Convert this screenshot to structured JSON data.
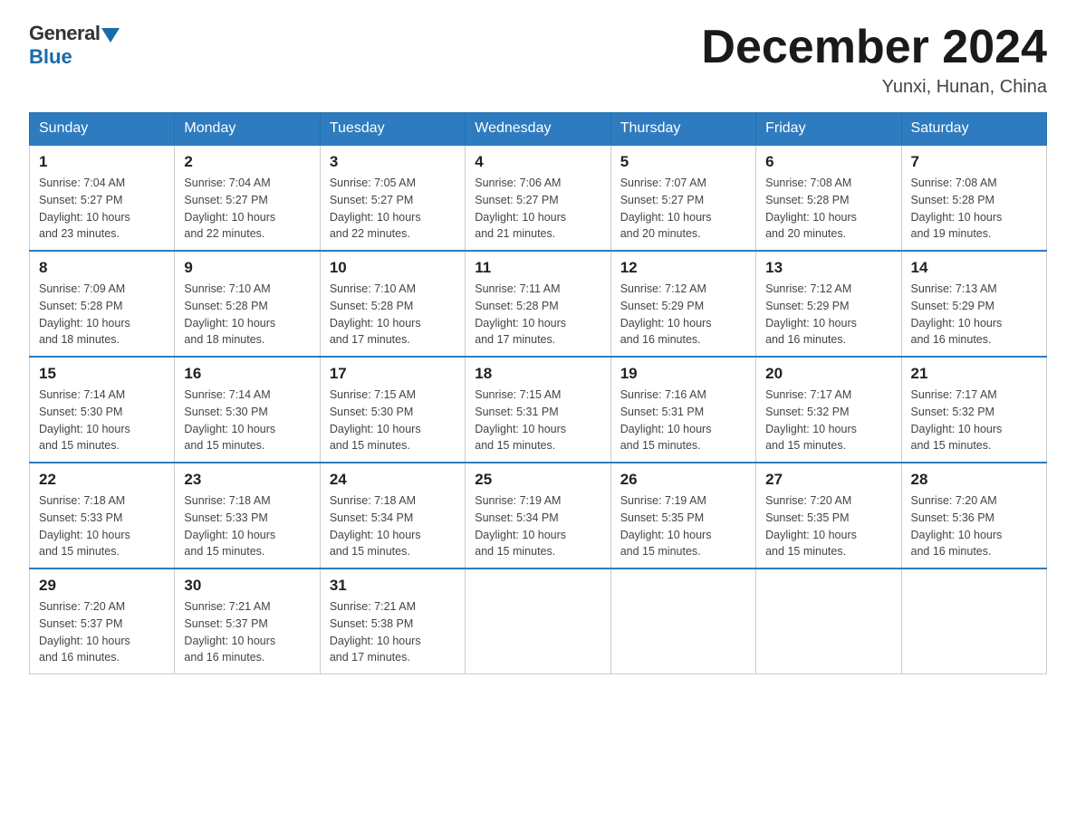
{
  "header": {
    "logo_general": "General",
    "logo_blue": "Blue",
    "month_title": "December 2024",
    "location": "Yunxi, Hunan, China"
  },
  "days_of_week": [
    "Sunday",
    "Monday",
    "Tuesday",
    "Wednesday",
    "Thursday",
    "Friday",
    "Saturday"
  ],
  "weeks": [
    [
      {
        "day": "1",
        "sunrise": "7:04 AM",
        "sunset": "5:27 PM",
        "daylight": "10 hours and 23 minutes."
      },
      {
        "day": "2",
        "sunrise": "7:04 AM",
        "sunset": "5:27 PM",
        "daylight": "10 hours and 22 minutes."
      },
      {
        "day": "3",
        "sunrise": "7:05 AM",
        "sunset": "5:27 PM",
        "daylight": "10 hours and 22 minutes."
      },
      {
        "day": "4",
        "sunrise": "7:06 AM",
        "sunset": "5:27 PM",
        "daylight": "10 hours and 21 minutes."
      },
      {
        "day": "5",
        "sunrise": "7:07 AM",
        "sunset": "5:27 PM",
        "daylight": "10 hours and 20 minutes."
      },
      {
        "day": "6",
        "sunrise": "7:08 AM",
        "sunset": "5:28 PM",
        "daylight": "10 hours and 20 minutes."
      },
      {
        "day": "7",
        "sunrise": "7:08 AM",
        "sunset": "5:28 PM",
        "daylight": "10 hours and 19 minutes."
      }
    ],
    [
      {
        "day": "8",
        "sunrise": "7:09 AM",
        "sunset": "5:28 PM",
        "daylight": "10 hours and 18 minutes."
      },
      {
        "day": "9",
        "sunrise": "7:10 AM",
        "sunset": "5:28 PM",
        "daylight": "10 hours and 18 minutes."
      },
      {
        "day": "10",
        "sunrise": "7:10 AM",
        "sunset": "5:28 PM",
        "daylight": "10 hours and 17 minutes."
      },
      {
        "day": "11",
        "sunrise": "7:11 AM",
        "sunset": "5:28 PM",
        "daylight": "10 hours and 17 minutes."
      },
      {
        "day": "12",
        "sunrise": "7:12 AM",
        "sunset": "5:29 PM",
        "daylight": "10 hours and 16 minutes."
      },
      {
        "day": "13",
        "sunrise": "7:12 AM",
        "sunset": "5:29 PM",
        "daylight": "10 hours and 16 minutes."
      },
      {
        "day": "14",
        "sunrise": "7:13 AM",
        "sunset": "5:29 PM",
        "daylight": "10 hours and 16 minutes."
      }
    ],
    [
      {
        "day": "15",
        "sunrise": "7:14 AM",
        "sunset": "5:30 PM",
        "daylight": "10 hours and 15 minutes."
      },
      {
        "day": "16",
        "sunrise": "7:14 AM",
        "sunset": "5:30 PM",
        "daylight": "10 hours and 15 minutes."
      },
      {
        "day": "17",
        "sunrise": "7:15 AM",
        "sunset": "5:30 PM",
        "daylight": "10 hours and 15 minutes."
      },
      {
        "day": "18",
        "sunrise": "7:15 AM",
        "sunset": "5:31 PM",
        "daylight": "10 hours and 15 minutes."
      },
      {
        "day": "19",
        "sunrise": "7:16 AM",
        "sunset": "5:31 PM",
        "daylight": "10 hours and 15 minutes."
      },
      {
        "day": "20",
        "sunrise": "7:17 AM",
        "sunset": "5:32 PM",
        "daylight": "10 hours and 15 minutes."
      },
      {
        "day": "21",
        "sunrise": "7:17 AM",
        "sunset": "5:32 PM",
        "daylight": "10 hours and 15 minutes."
      }
    ],
    [
      {
        "day": "22",
        "sunrise": "7:18 AM",
        "sunset": "5:33 PM",
        "daylight": "10 hours and 15 minutes."
      },
      {
        "day": "23",
        "sunrise": "7:18 AM",
        "sunset": "5:33 PM",
        "daylight": "10 hours and 15 minutes."
      },
      {
        "day": "24",
        "sunrise": "7:18 AM",
        "sunset": "5:34 PM",
        "daylight": "10 hours and 15 minutes."
      },
      {
        "day": "25",
        "sunrise": "7:19 AM",
        "sunset": "5:34 PM",
        "daylight": "10 hours and 15 minutes."
      },
      {
        "day": "26",
        "sunrise": "7:19 AM",
        "sunset": "5:35 PM",
        "daylight": "10 hours and 15 minutes."
      },
      {
        "day": "27",
        "sunrise": "7:20 AM",
        "sunset": "5:35 PM",
        "daylight": "10 hours and 15 minutes."
      },
      {
        "day": "28",
        "sunrise": "7:20 AM",
        "sunset": "5:36 PM",
        "daylight": "10 hours and 16 minutes."
      }
    ],
    [
      {
        "day": "29",
        "sunrise": "7:20 AM",
        "sunset": "5:37 PM",
        "daylight": "10 hours and 16 minutes."
      },
      {
        "day": "30",
        "sunrise": "7:21 AM",
        "sunset": "5:37 PM",
        "daylight": "10 hours and 16 minutes."
      },
      {
        "day": "31",
        "sunrise": "7:21 AM",
        "sunset": "5:38 PM",
        "daylight": "10 hours and 17 minutes."
      },
      null,
      null,
      null,
      null
    ]
  ],
  "labels": {
    "sunrise": "Sunrise:",
    "sunset": "Sunset:",
    "daylight": "Daylight:"
  }
}
